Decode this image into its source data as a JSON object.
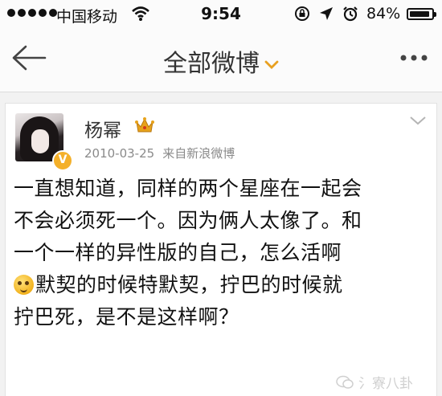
{
  "status_bar": {
    "carrier": "中国移动",
    "time": "9:54",
    "battery": "84%"
  },
  "nav": {
    "title": "全部微博"
  },
  "post": {
    "author": "杨幂",
    "date": "2010-03-25",
    "source": "来自新浪微博",
    "lines": [
      "一直想知道，同样的两个星座在一起会",
      "不会必须死一个。因为俩人太像了。和",
      "一个一样的异性版的自己，怎么活啊",
      "默契的时候特默契，拧巴的时候就",
      "拧巴死，是不是这样啊？"
    ],
    "verified_badge": "V"
  },
  "watermark": "氵寮八卦",
  "colors": {
    "accent": "#f4b02a",
    "meta": "#8a8a8a",
    "background": "#f2f2f2"
  },
  "icons": [
    "signal-dots-icon",
    "wifi-icon",
    "rotation-lock-icon",
    "location-arrow-icon",
    "alarm-icon",
    "battery-icon",
    "back-arrow-icon",
    "dropdown-chevron-icon",
    "more-dots-icon",
    "crown-icon",
    "verified-badge-icon",
    "card-menu-chevron-icon",
    "emoji-icon",
    "wechat-icon"
  ]
}
